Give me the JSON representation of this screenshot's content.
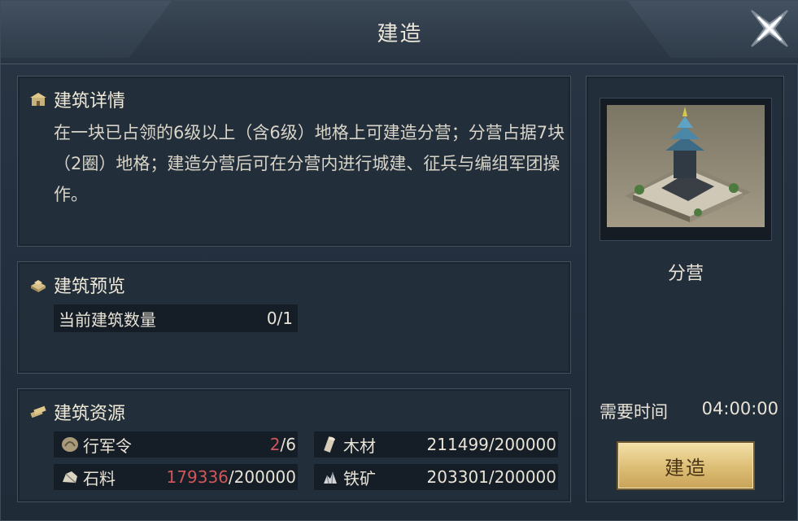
{
  "dialog": {
    "title": "建造"
  },
  "details": {
    "heading": "建筑详情",
    "description": "在一块已占领的6级以上（含6级）地格上可建造分营；分营占据7块（2圈）地格；建造分营后可在分营内进行城建、征兵与编组军团操作。"
  },
  "preview": {
    "heading": "建筑预览",
    "count_label": "当前建筑数量",
    "count_value": "0/1"
  },
  "resources": {
    "heading": "建筑资源",
    "items": [
      {
        "name": "行军令",
        "icon": "march-order-icon",
        "have": "2",
        "need": "/6",
        "insufficient": true
      },
      {
        "name": "木材",
        "icon": "wood-icon",
        "have": "211499",
        "need": "/200000",
        "insufficient": false
      },
      {
        "name": "石料",
        "icon": "stone-icon",
        "have": "179336",
        "need": "/200000",
        "insufficient": true
      },
      {
        "name": "铁矿",
        "icon": "iron-ore-icon",
        "have": "203301",
        "need": "/200000",
        "insufficient": false
      }
    ]
  },
  "building": {
    "name": "分营",
    "time_label": "需要时间",
    "time_value": "04:00:00",
    "build_button": "建造"
  },
  "colors": {
    "insufficient": "#d0565a",
    "button_gold": "#dcbd74"
  }
}
